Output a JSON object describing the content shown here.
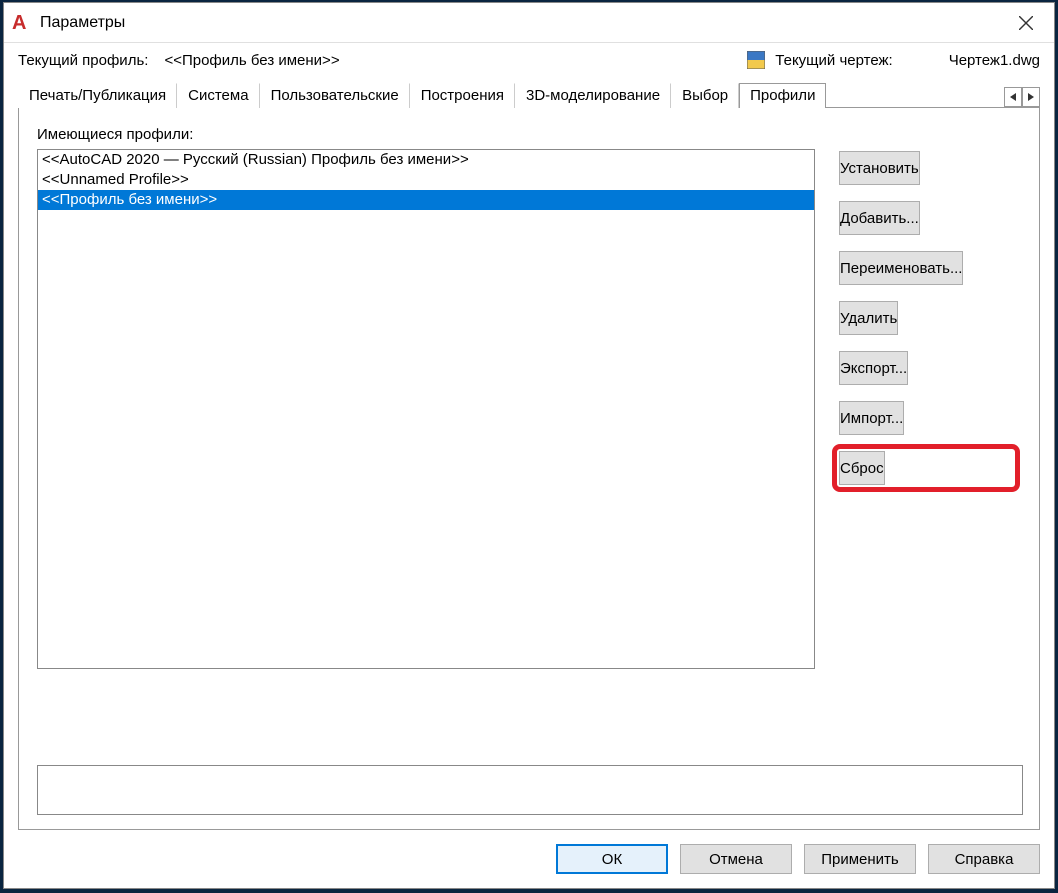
{
  "titlebar": {
    "title": "Параметры"
  },
  "info": {
    "current_profile_label": "Текущий профиль:",
    "current_profile_value": "<<Профиль без имени>>",
    "current_drawing_label": "Текущий чертеж:",
    "current_drawing_value": "Чертеж1.dwg"
  },
  "tabs": {
    "items": [
      "Печать/Публикация",
      "Система",
      "Пользовательские",
      "Построения",
      "3D-моделирование",
      "Выбор",
      "Профили"
    ],
    "active_index": 6
  },
  "profiles": {
    "list_label": "Имеющиеся профили:",
    "items": [
      "<<AutoCAD 2020 — Русский (Russian) Профиль без имени>>",
      "<<Unnamed Profile>>",
      "<<Профиль без имени>>"
    ],
    "selected_index": 2
  },
  "buttons": {
    "set_current": "Установить",
    "add": "Добавить...",
    "rename": "Переименовать...",
    "delete": "Удалить",
    "export": "Экспорт...",
    "import": "Импорт...",
    "reset": "Сброс"
  },
  "footer": {
    "ok": "ОК",
    "cancel": "Отмена",
    "apply": "Применить",
    "help": "Справка"
  }
}
